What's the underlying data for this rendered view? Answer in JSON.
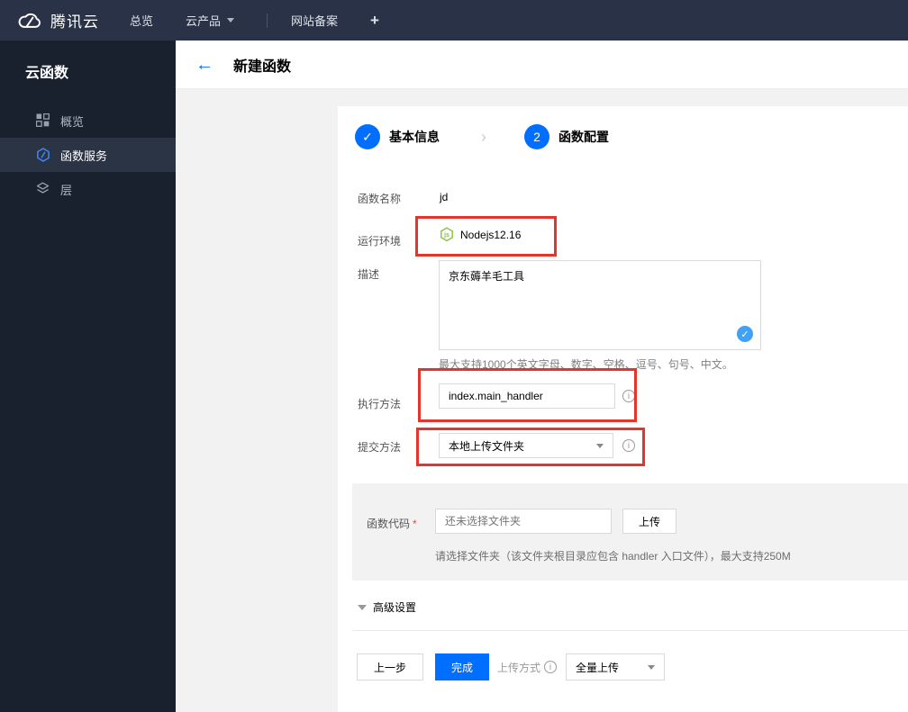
{
  "topbar": {
    "brand": "腾讯云",
    "nav": [
      {
        "label": "总览"
      },
      {
        "label": "云产品"
      },
      {
        "label": "网站备案"
      },
      {
        "label": "+"
      }
    ]
  },
  "sidebar": {
    "title": "云函数",
    "items": [
      {
        "label": "概览",
        "icon": "grid-icon",
        "active": false
      },
      {
        "label": "函数服务",
        "icon": "function-icon",
        "active": true
      },
      {
        "label": "层",
        "icon": "layers-icon",
        "active": false
      }
    ]
  },
  "header": {
    "title": "新建函数"
  },
  "steps": {
    "step1_label": "基本信息",
    "separator": "›",
    "step2_number": "2",
    "step2_label": "函数配置"
  },
  "form": {
    "name_label": "函数名称",
    "name_value": "jd",
    "runtime_label": "运行环境",
    "runtime_value": "Nodejs12.16",
    "runtime_icon_text": "js",
    "desc_label": "描述",
    "desc_value": "京东薅羊毛工具",
    "desc_help": "最大支持1000个英文字母、数字、空格、逗号、句号、中文。",
    "handler_label": "执行方法",
    "handler_value": "index.main_handler",
    "submit_label": "提交方法",
    "submit_value": "本地上传文件夹",
    "code_label": "函数代码",
    "required_mark": "*",
    "code_placeholder": "还未选择文件夹",
    "upload_button": "上传",
    "code_help": "请选择文件夹（该文件夹根目录应包含 handler 入口文件），最大支持250M",
    "advanced_label": "高级设置"
  },
  "footer": {
    "prev_button": "上一步",
    "finish_button": "完成",
    "upload_mode_label": "上传方式",
    "upload_mode_value": "全量上传"
  },
  "icons": {
    "back": "←",
    "check": "✓",
    "info": "i"
  },
  "colors": {
    "accent": "#006eff",
    "annotation_red": "#e5342c",
    "node_green": "#85c241",
    "topbar_bg": "#293246",
    "sidebar_bg": "#1a212e"
  }
}
